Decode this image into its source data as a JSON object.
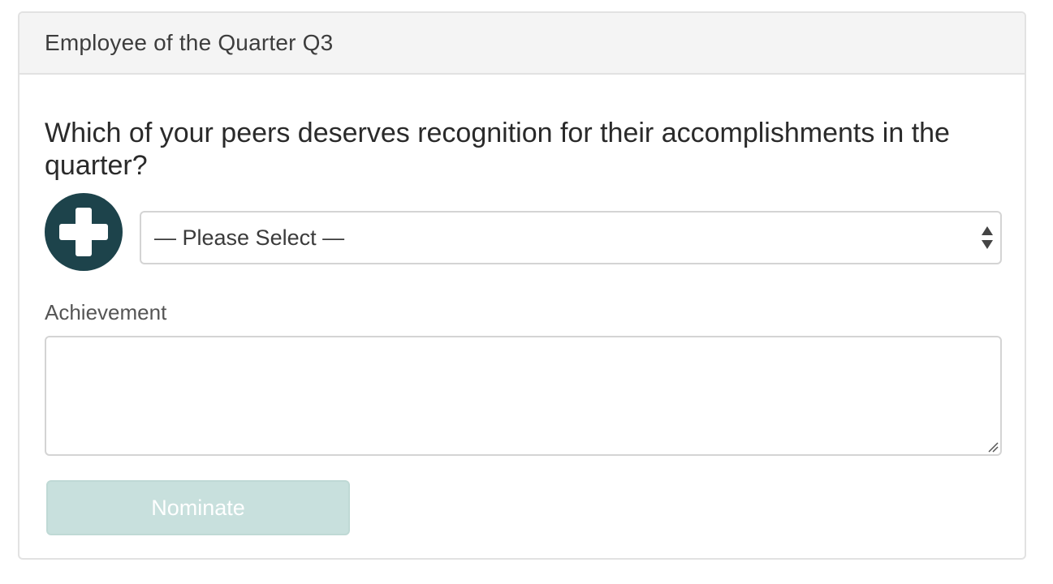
{
  "card": {
    "title": "Employee of the Quarter Q3"
  },
  "form": {
    "question": "Which of your peers deserves recognition for their accomplishments in the quarter?",
    "add_button_icon": "plus-icon",
    "select": {
      "selected_value": "— Please Select —",
      "icon": "sort-arrows-icon"
    },
    "achievement_label": "Achievement",
    "achievement_value": "",
    "submit_label": "Nominate"
  },
  "colors": {
    "accent_dark": "#1d434b",
    "button_disabled_bg": "#c8e0dd",
    "header_bg": "#f4f4f4",
    "border": "#e2e2e2"
  }
}
